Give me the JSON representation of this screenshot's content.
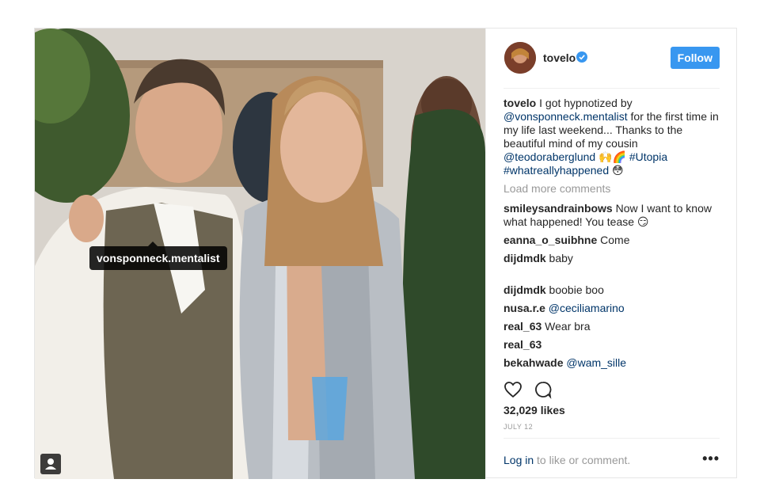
{
  "post": {
    "username": "tovelo",
    "follow_label": "Follow",
    "tag_username": "vonsponneck.mentalist",
    "caption": {
      "user": "tovelo",
      "text1": " I got hypnotized by ",
      "mention1": "@vonsponneck.mentalist",
      "text2": " for the first time in my life last weekend... Thanks to the beautiful mind of my cousin ",
      "mention2": "@teodoraberglund",
      "emojis1": " 🙌🌈 ",
      "hashtag1": "#Utopia",
      "hashtag2": "#whatreallyhappened",
      "emoji2": " 😳"
    },
    "load_more": "Load more comments",
    "comments": [
      {
        "user": "smileysandrainbows",
        "text": " Now I want to know what happened! You tease 😏"
      },
      {
        "user": "eanna_o_suibhne",
        "text": " Come"
      },
      {
        "user": "dijdmdk",
        "text": " baby"
      },
      {
        "user": "dijdmdk",
        "text": " boobie boo"
      },
      {
        "user": "nusa.r.e",
        "mention": " @ceciliamarino"
      },
      {
        "user": "real_63",
        "text": " Wear bra"
      },
      {
        "user": "real_63",
        "text": ""
      },
      {
        "user": "bekahwade",
        "mention": " @wam_sille"
      }
    ],
    "likes": "32,029 likes",
    "date": "JULY 12",
    "login_link": "Log in",
    "login_rest": " to like or comment.",
    "more": "•••"
  },
  "icons": {
    "verified": "verified-badge-icon",
    "like": "heart-icon",
    "comment": "comment-bubble-icon",
    "tag": "user-tag-icon",
    "more": "more-options-icon"
  },
  "colors": {
    "accent": "#3897f0",
    "link": "#003569",
    "muted": "#999999"
  }
}
